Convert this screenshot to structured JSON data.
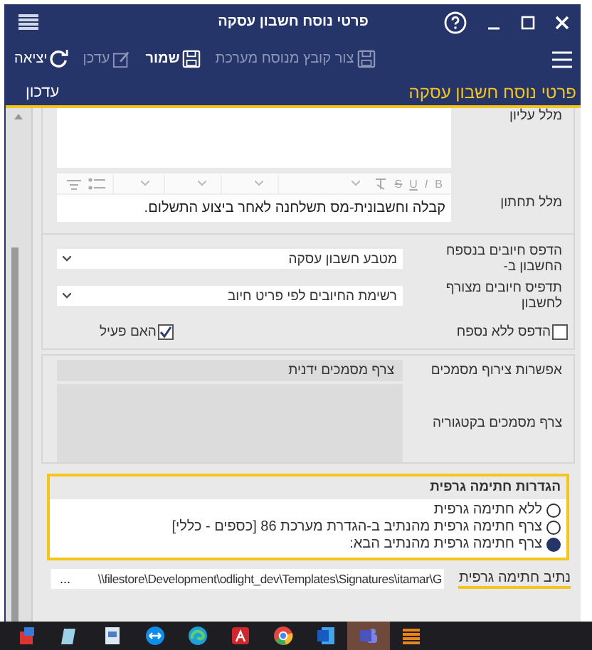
{
  "window": {
    "title": "פרטי נוסח חשבון עסקה"
  },
  "toolbar": [
    {
      "kind": "create",
      "label": "צור קובץ מנוסח מערכת",
      "disabled": true
    },
    {
      "kind": "save",
      "label": "שמור",
      "disabled": false
    },
    {
      "kind": "edit",
      "label": "עדכן",
      "disabled": true
    },
    {
      "kind": "exit",
      "label": "יציאה",
      "disabled": false
    }
  ],
  "header": {
    "title": "פרטי נוסח חשבון עסקה",
    "mode": "עדכון"
  },
  "editors": [
    {
      "label": "מלל עליון"
    },
    {
      "label": "מלל תחתון",
      "format_buttons": [
        "B",
        "I",
        "U",
        "S"
      ],
      "text": "קבלה וחשבונית-מס תשלחנה לאחר ביצוע התשלום."
    }
  ],
  "print_settings": {
    "rows": [
      {
        "label": "הדפס חיובים בנספח החשבון ב-",
        "value": "מטבע חשבון עסקה"
      },
      {
        "label": "תדפיס חיובים מצורף לחשבון",
        "value": "רשימת החיובים  לפי פריט חיוב"
      }
    ],
    "checkboxes": [
      {
        "label": "הדפס ללא נספח",
        "checked": false
      },
      {
        "label": "האם פעיל",
        "checked": true
      }
    ]
  },
  "attachments": [
    {
      "label": "אפשרות צירוף מסמכים",
      "value": "צרף מסמכים ידנית"
    },
    {
      "label": "צרף מסמכים בקטגוריה"
    }
  ],
  "signature": {
    "title": "הגדרות חתימה גרפית",
    "options": [
      {
        "label": "ללא חתימה גרפית",
        "selected": false
      },
      {
        "label": "צרף חתימה גרפית מהנתיב ב-הגדרת מערכת 86 [כספים - כללי]",
        "selected": false
      },
      {
        "label": "צרף חתימה גרפית מהנתיב הבא:",
        "selected": true
      }
    ],
    "path_label": "נתיב חתימה גרפית",
    "path": "\\\\filestore\\Development\\odlight_dev\\Templates\\Signatures\\itamar\\G",
    "browse": "..."
  },
  "taskbar": [
    {
      "kind": "paint",
      "selected": false
    },
    {
      "kind": "notepad",
      "selected": false
    },
    {
      "kind": "document",
      "selected": false
    },
    {
      "kind": "remote",
      "selected": false
    },
    {
      "kind": "browser",
      "selected": false
    },
    {
      "kind": "pdf",
      "selected": false
    },
    {
      "kind": "chrome",
      "selected": false
    },
    {
      "kind": "word",
      "selected": false
    },
    {
      "kind": "teams",
      "selected": true
    },
    {
      "kind": "app",
      "selected": false
    }
  ]
}
